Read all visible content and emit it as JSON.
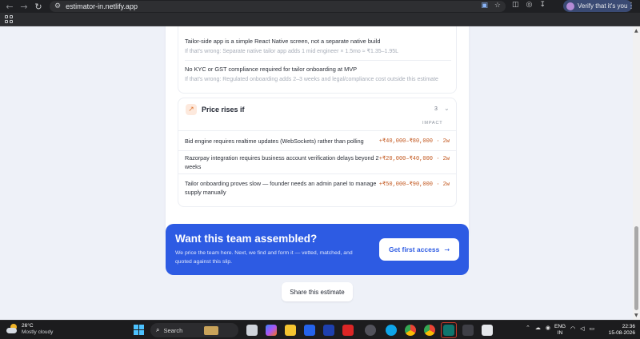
{
  "browser": {
    "url": "estimator-in.netlify.app",
    "profile_label": "Verify that it's you"
  },
  "assumptions": [
    {
      "text": "Tailor-side app is a simple React Native screen, not a separate native build",
      "if_wrong": "If that's wrong: Separate native tailor app adds 1 mid engineer × 1.5mo ≈ ₹1.35–1.95L"
    },
    {
      "text": "No KYC or GST compliance required for tailor onboarding at MVP",
      "if_wrong": "If that's wrong: Regulated onboarding adds 2–3 weeks and legal/compliance cost outside this estimate"
    }
  ],
  "price_rises": {
    "title": "Price rises if",
    "count": "3",
    "impact_header": "IMPACT",
    "rows": [
      {
        "text": "Bid engine requires realtime updates (WebSockets) rather than polling",
        "impact": "+₹40,000–₹80,000 · 2w"
      },
      {
        "text": "Razorpay integration requires business account verification delays beyond 2 weeks",
        "impact": "+₹20,000–₹40,000 · 2w"
      },
      {
        "text": "Tailor onboarding proves slow — founder needs an admin panel to manage supply manually",
        "impact": "+₹50,000–₹90,000 · 2w"
      }
    ]
  },
  "cta": {
    "title": "Want this team assembled?",
    "description": "We price the team here. Next, we find and form it — vetted, matched, and quoted against this slip.",
    "button_label": "Get first access"
  },
  "share_label": "Share this estimate",
  "taskbar": {
    "temperature": "26°C",
    "condition": "Mostly cloudy",
    "search_label": "Search",
    "lang_1": "ENG",
    "lang_2": "IN",
    "time": "22:36",
    "date": "15-08-2026"
  },
  "colors": {
    "accent": "#2d5be3",
    "impact": "#c2571e"
  }
}
